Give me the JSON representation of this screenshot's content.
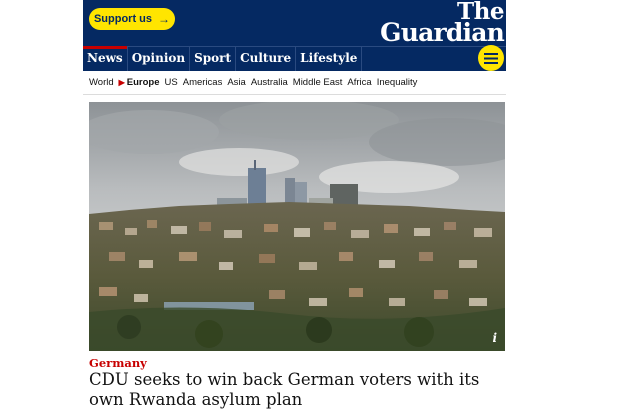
{
  "header": {
    "support_label": "Support us",
    "support_arrow": "→",
    "logo_line1": "The",
    "logo_line2": "Guardian"
  },
  "nav": {
    "pillars": [
      {
        "label": "News",
        "active": true
      },
      {
        "label": "Opinion"
      },
      {
        "label": "Sport"
      },
      {
        "label": "Culture"
      },
      {
        "label": "Lifestyle"
      }
    ],
    "menu_icon": "hamburger-icon"
  },
  "subnav": {
    "items": [
      "World",
      "Europe",
      "US",
      "Americas",
      "Asia",
      "Australia",
      "Middle East",
      "Africa",
      "Inequality"
    ],
    "active": "Europe",
    "active_marker": "▶"
  },
  "article": {
    "image_caption_icon": "i",
    "kicker": "Germany",
    "headline": "CDU seeks to win back German voters with its own Rwanda asylum plan"
  },
  "colors": {
    "brand_blue": "#052962",
    "support_yellow": "#ffe500",
    "news_red": "#c70000"
  }
}
